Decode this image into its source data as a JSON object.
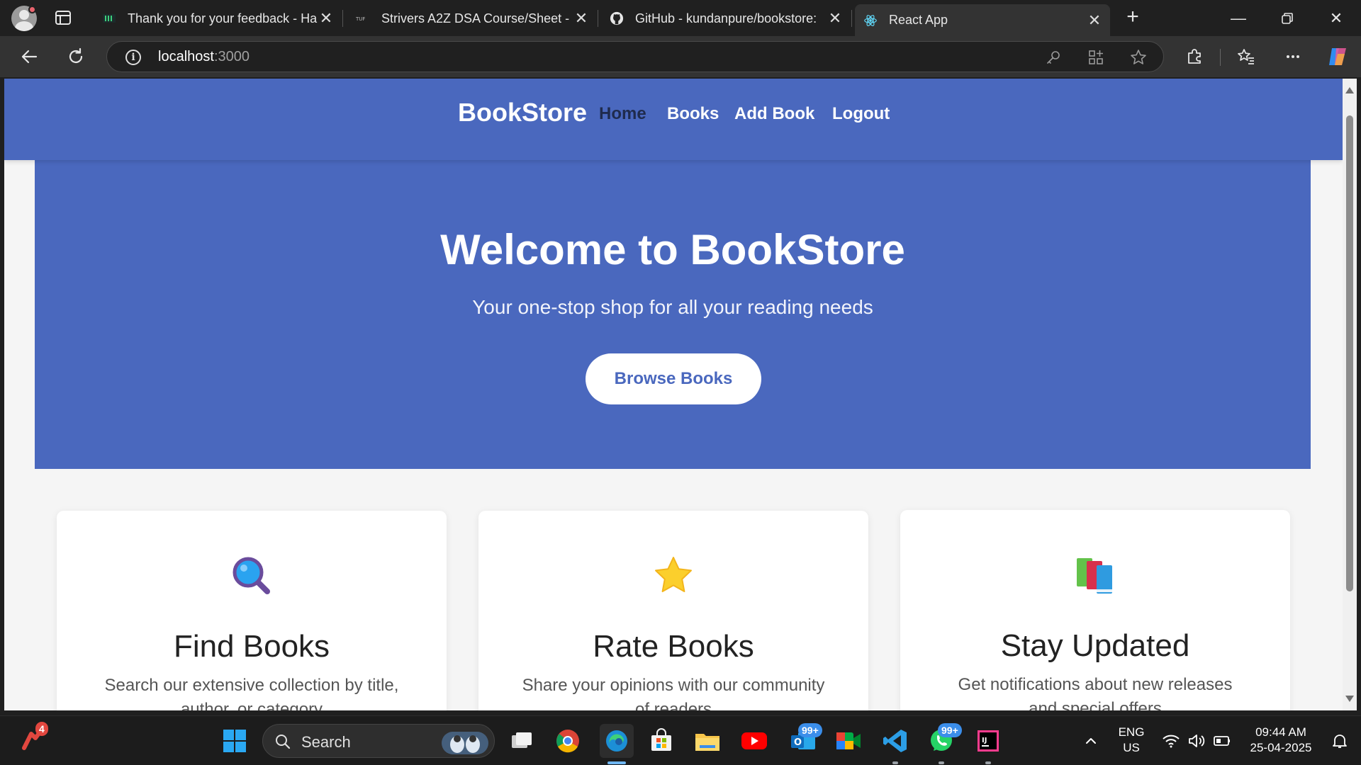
{
  "browser": {
    "tabs": [
      {
        "title": "Thank you for your feedback - Ha",
        "favicon": "hackerearth-icon"
      },
      {
        "title": "Strivers A2Z DSA Course/Sheet - ",
        "favicon": "takeuforward-icon"
      },
      {
        "title": "GitHub - kundanpure/bookstore:",
        "favicon": "github-icon"
      },
      {
        "title": "React App",
        "favicon": "react-icon"
      }
    ],
    "url_host": "localhost",
    "url_port": ":3000"
  },
  "page": {
    "brand": "BookStore",
    "nav": [
      "Home",
      "Books",
      "Add Book",
      "Logout"
    ],
    "hero": {
      "title": "Welcome to BookStore",
      "subtitle": "Your one-stop shop for all your reading needs",
      "button": "Browse Books"
    },
    "features": [
      {
        "icon": "magnifier-icon",
        "title": "Find Books",
        "text": "Search our extensive collection by title, author, or category"
      },
      {
        "icon": "star-icon",
        "title": "Rate Books",
        "text": "Share your opinions with our community of readers"
      },
      {
        "icon": "books-icon",
        "title": "Stay Updated",
        "text": "Get notifications about new releases and special offers"
      }
    ],
    "colors": {
      "primary": "#4a68be",
      "nav_active": "#1f2b4d",
      "background": "#f5f5f5"
    }
  },
  "taskbar": {
    "search_label": "Search",
    "notification_count": "4",
    "outlook_badge": "99+",
    "whatsapp_badge": "99+",
    "language": "ENG",
    "region": "US",
    "time": "09:44 AM",
    "date": "25-04-2025"
  }
}
